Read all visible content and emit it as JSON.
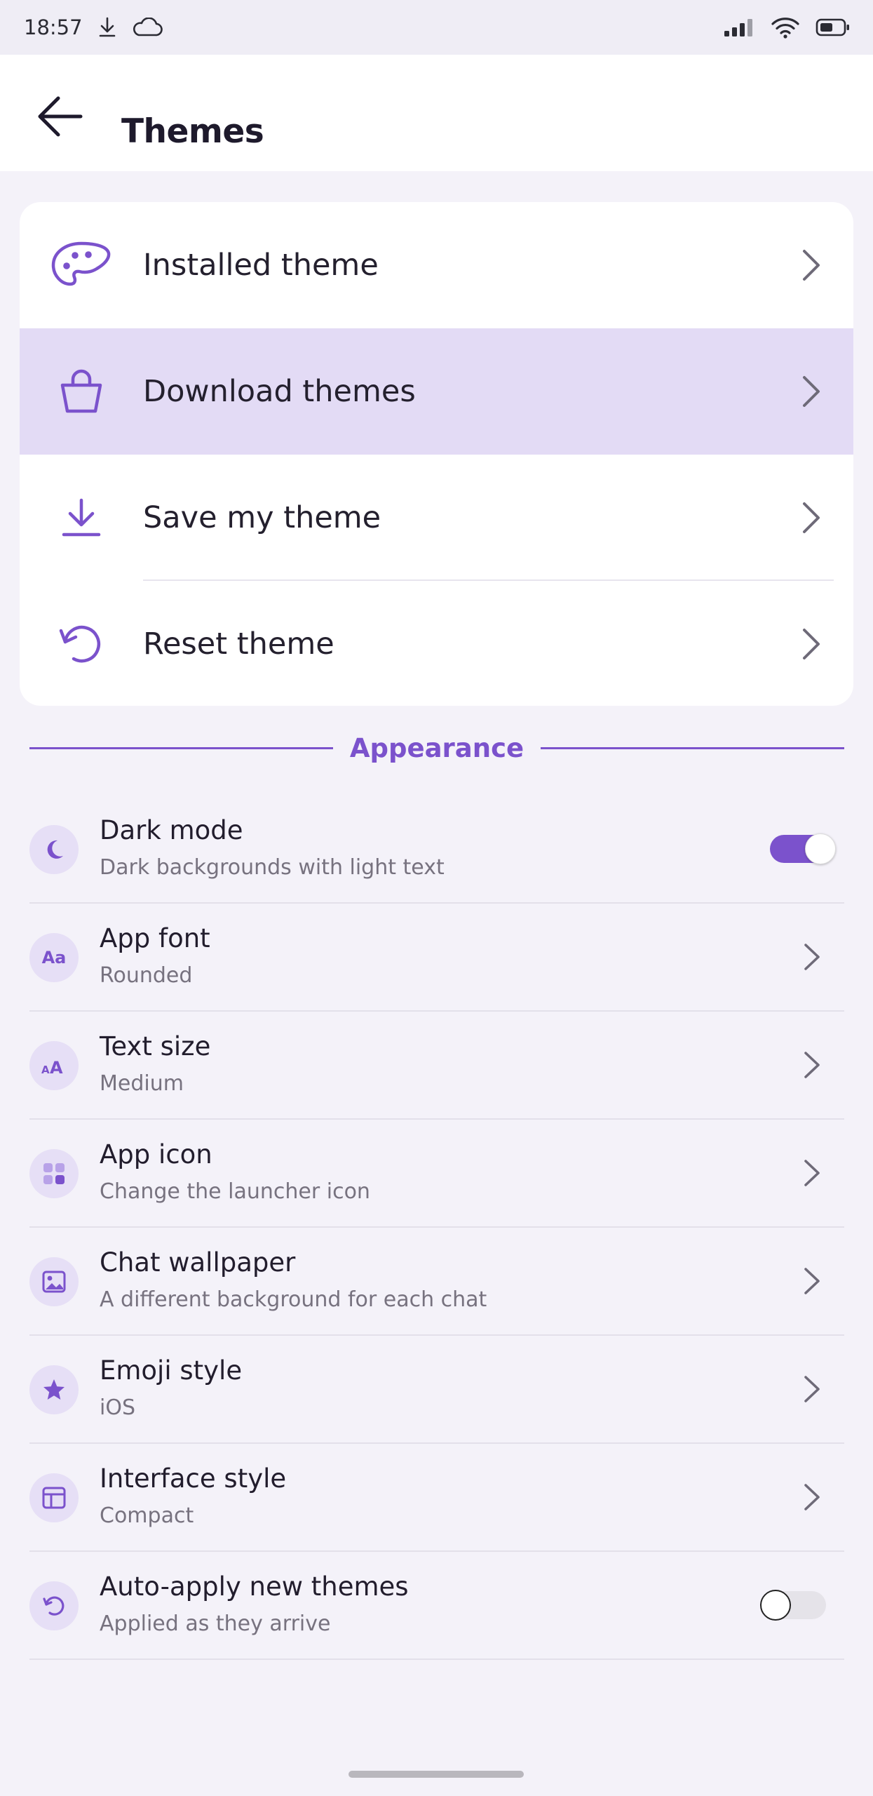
{
  "status_bar": {
    "time": "18:57",
    "left_icons": [
      "download-icon",
      "cloud-icon"
    ],
    "right_icons": [
      "signal-icon",
      "wifi-icon",
      "battery-icon"
    ]
  },
  "header": {
    "back_icon": "arrow-left-icon",
    "title": "Themes"
  },
  "theme_menu": [
    {
      "id": "installed",
      "label": "Installed theme",
      "icon": "palette-icon",
      "highlighted": false
    },
    {
      "id": "download",
      "label": "Download themes",
      "icon": "shopping-bag-icon",
      "highlighted": true
    },
    {
      "id": "save",
      "label": "Save my theme",
      "icon": "download-icon",
      "highlighted": false
    },
    {
      "id": "reset",
      "label": "Reset theme",
      "icon": "reset-icon",
      "highlighted": false
    }
  ],
  "appearance": {
    "section_title": "Appearance",
    "items": [
      {
        "id": "dark-mode",
        "title": "Dark mode",
        "subtitle": "Dark backgrounds with light text",
        "icon": "moon-icon",
        "control": "toggle",
        "toggle_on": true
      },
      {
        "id": "app-font",
        "title": "App font",
        "subtitle": "Rounded",
        "icon": "font-icon",
        "icon_text": "Aa",
        "control": "chevron"
      },
      {
        "id": "text-size",
        "title": "Text size",
        "subtitle": "Medium",
        "icon": "text-size-icon",
        "icon_text": "AA",
        "control": "chevron"
      },
      {
        "id": "app-icon",
        "title": "App icon",
        "subtitle": "Change the launcher icon",
        "icon": "grid-icon",
        "control": "chevron"
      },
      {
        "id": "chat-wallpaper",
        "title": "Chat wallpaper",
        "subtitle": "A different background for each chat",
        "icon": "image-icon",
        "control": "chevron"
      },
      {
        "id": "emoji-style",
        "title": "Emoji style",
        "subtitle": "iOS",
        "icon": "star-icon",
        "control": "chevron"
      },
      {
        "id": "interface-style",
        "title": "Interface style",
        "subtitle": "Compact",
        "icon": "layout-icon",
        "control": "chevron"
      },
      {
        "id": "auto-apply",
        "title": "Auto-apply new themes",
        "subtitle": "Applied as they arrive",
        "icon": "refresh-icon",
        "control": "toggle",
        "toggle_on": false
      }
    ]
  },
  "colors": {
    "accent": "#7b52cc",
    "highlight": "#e3dbf5",
    "background": "#f4f2f9",
    "icon_bubble": "#e6dff6"
  }
}
